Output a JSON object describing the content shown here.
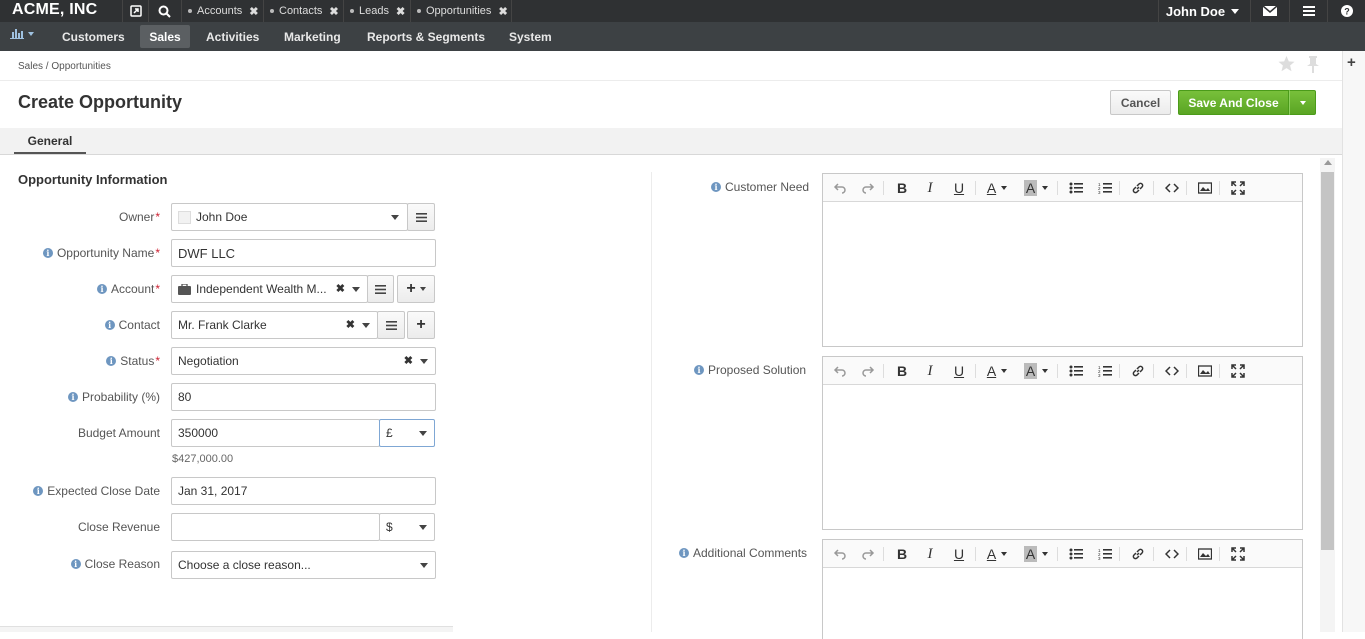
{
  "topbar": {
    "logo": "ACME, INC",
    "tabs": [
      {
        "label": "Accounts"
      },
      {
        "label": "Contacts"
      },
      {
        "label": "Leads"
      },
      {
        "label": "Opportunities"
      }
    ],
    "user": "John Doe"
  },
  "nav": {
    "items": [
      "Customers",
      "Sales",
      "Activities",
      "Marketing",
      "Reports & Segments",
      "System"
    ],
    "active": "Sales"
  },
  "breadcrumb": "Sales / Opportunities",
  "page_title": "Create Opportunity",
  "actions": {
    "cancel": "Cancel",
    "save": "Save And Close"
  },
  "tabs": {
    "general": "General"
  },
  "form": {
    "section_title": "Opportunity Information",
    "owner": {
      "label": "Owner",
      "value": "John Doe"
    },
    "opportunity_name": {
      "label": "Opportunity Name",
      "value": "DWF LLC"
    },
    "account": {
      "label": "Account",
      "value": "Independent Wealth M..."
    },
    "contact": {
      "label": "Contact",
      "value": "Mr. Frank Clarke"
    },
    "status": {
      "label": "Status",
      "value": "Negotiation"
    },
    "probability": {
      "label": "Probability (%)",
      "value": "80"
    },
    "budget_amount": {
      "label": "Budget Amount",
      "value": "350000",
      "currency": "£",
      "converted": "$427,000.00"
    },
    "expected_close_date": {
      "label": "Expected Close Date",
      "value": "Jan 31, 2017"
    },
    "close_revenue": {
      "label": "Close Revenue",
      "value": "",
      "currency": "$"
    },
    "close_reason": {
      "label": "Close Reason",
      "value": "Choose a close reason..."
    }
  },
  "editors": [
    {
      "label": "Customer Need"
    },
    {
      "label": "Proposed Solution"
    },
    {
      "label": "Additional Comments"
    }
  ],
  "colors": {
    "topbar": "#2f3133",
    "navbar": "#3d4144",
    "save": "#6bb531",
    "info": "#6e96c0",
    "required": "#cc2233"
  }
}
